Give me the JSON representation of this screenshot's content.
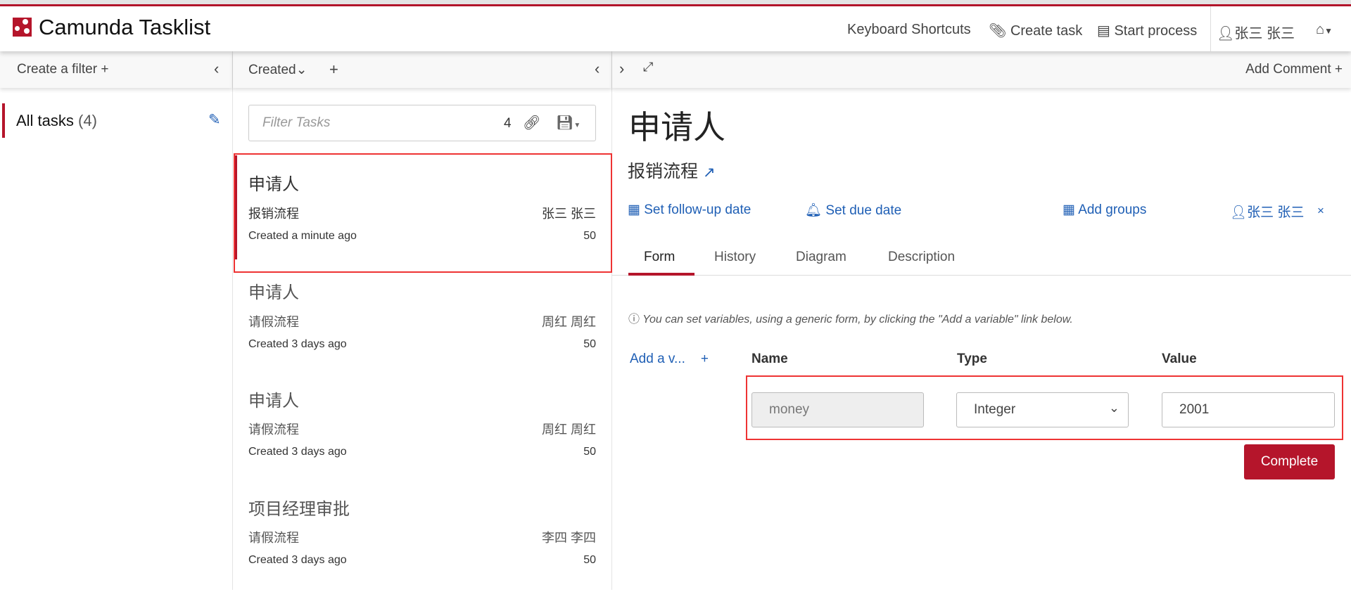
{
  "header": {
    "brand": "Camunda Tasklist",
    "nav": {
      "keyboard_shortcuts": "Keyboard Shortcuts",
      "create_task": "Create task",
      "start_process": "Start process",
      "user": "张三 张三"
    },
    "accent": "#b5152b"
  },
  "filters": {
    "create_label": "Create a filter",
    "items": [
      {
        "label": "All tasks",
        "count": "(4)"
      }
    ]
  },
  "tasklist": {
    "sort_label": "Created",
    "search_placeholder": "Filter Tasks",
    "count": "4",
    "tasks": [
      {
        "name": "申请人",
        "process": "报销流程",
        "assignee": "张三 张三",
        "created": "Created a minute ago",
        "priority": "50",
        "selected": true
      },
      {
        "name": "申请人",
        "process": "请假流程",
        "assignee": "周红 周红",
        "created": "Created 3 days ago",
        "priority": "50"
      },
      {
        "name": "申请人",
        "process": "请假流程",
        "assignee": "周红 周红",
        "created": "Created 3 days ago",
        "priority": "50"
      },
      {
        "name": "项目经理审批",
        "process": "请假流程",
        "assignee": "李四 李四",
        "created": "Created 3 days ago",
        "priority": "50"
      }
    ]
  },
  "detail": {
    "add_comment": "Add Comment",
    "title": "申请人",
    "process": "报销流程",
    "actions": {
      "follow_up": "Set follow-up date",
      "due": "Set due date",
      "groups": "Add groups",
      "assignee": "张三 张三",
      "remove": "×"
    },
    "tabs": [
      "Form",
      "History",
      "Diagram",
      "Description"
    ],
    "active_tab": "Form",
    "info": "You can set variables, using a generic form, by clicking the \"Add a variable\" link below.",
    "add_variable": "Add a v...",
    "columns": {
      "name": "Name",
      "type": "Type",
      "value": "Value"
    },
    "variable": {
      "name": "money",
      "type": "Integer",
      "value": "2001"
    },
    "complete": "Complete"
  }
}
